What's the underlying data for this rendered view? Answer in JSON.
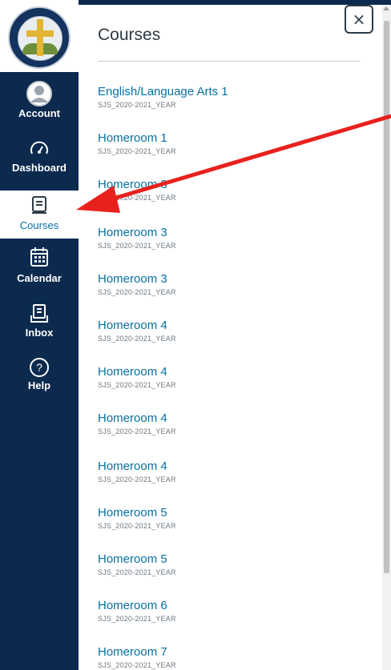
{
  "sidebar": {
    "logo_alt": "St. Junipero Serra Catholic School",
    "items": [
      {
        "label": "Account",
        "icon": "account-icon"
      },
      {
        "label": "Dashboard",
        "icon": "dashboard-icon"
      },
      {
        "label": "Courses",
        "icon": "courses-icon",
        "active": true
      },
      {
        "label": "Calendar",
        "icon": "calendar-icon"
      },
      {
        "label": "Inbox",
        "icon": "inbox-icon"
      },
      {
        "label": "Help",
        "icon": "help-icon"
      }
    ]
  },
  "tray": {
    "title": "Courses",
    "close_label": "×",
    "courses": [
      {
        "name": "English/Language Arts 1",
        "term": "SJS_2020-2021_YEAR"
      },
      {
        "name": "Homeroom 1",
        "term": "SJS_2020-2021_YEAR"
      },
      {
        "name": "Homeroom 3",
        "term": "SJS_2020-2021_YEAR"
      },
      {
        "name": "Homeroom 3",
        "term": "SJS_2020-2021_YEAR"
      },
      {
        "name": "Homeroom 3",
        "term": "SJS_2020-2021_YEAR"
      },
      {
        "name": "Homeroom 4",
        "term": "SJS_2020-2021_YEAR"
      },
      {
        "name": "Homeroom 4",
        "term": "SJS_2020-2021_YEAR"
      },
      {
        "name": "Homeroom 4",
        "term": "SJS_2020-2021_YEAR"
      },
      {
        "name": "Homeroom 4",
        "term": "SJS_2020-2021_YEAR"
      },
      {
        "name": "Homeroom 5",
        "term": "SJS_2020-2021_YEAR"
      },
      {
        "name": "Homeroom 5",
        "term": "SJS_2020-2021_YEAR"
      },
      {
        "name": "Homeroom 6",
        "term": "SJS_2020-2021_YEAR"
      },
      {
        "name": "Homeroom 7",
        "term": "SJS_2020-2021_YEAR"
      }
    ]
  },
  "colors": {
    "nav_bg": "#0c2a4e",
    "link": "#0770a3",
    "annotation_arrow": "#e8211d"
  }
}
